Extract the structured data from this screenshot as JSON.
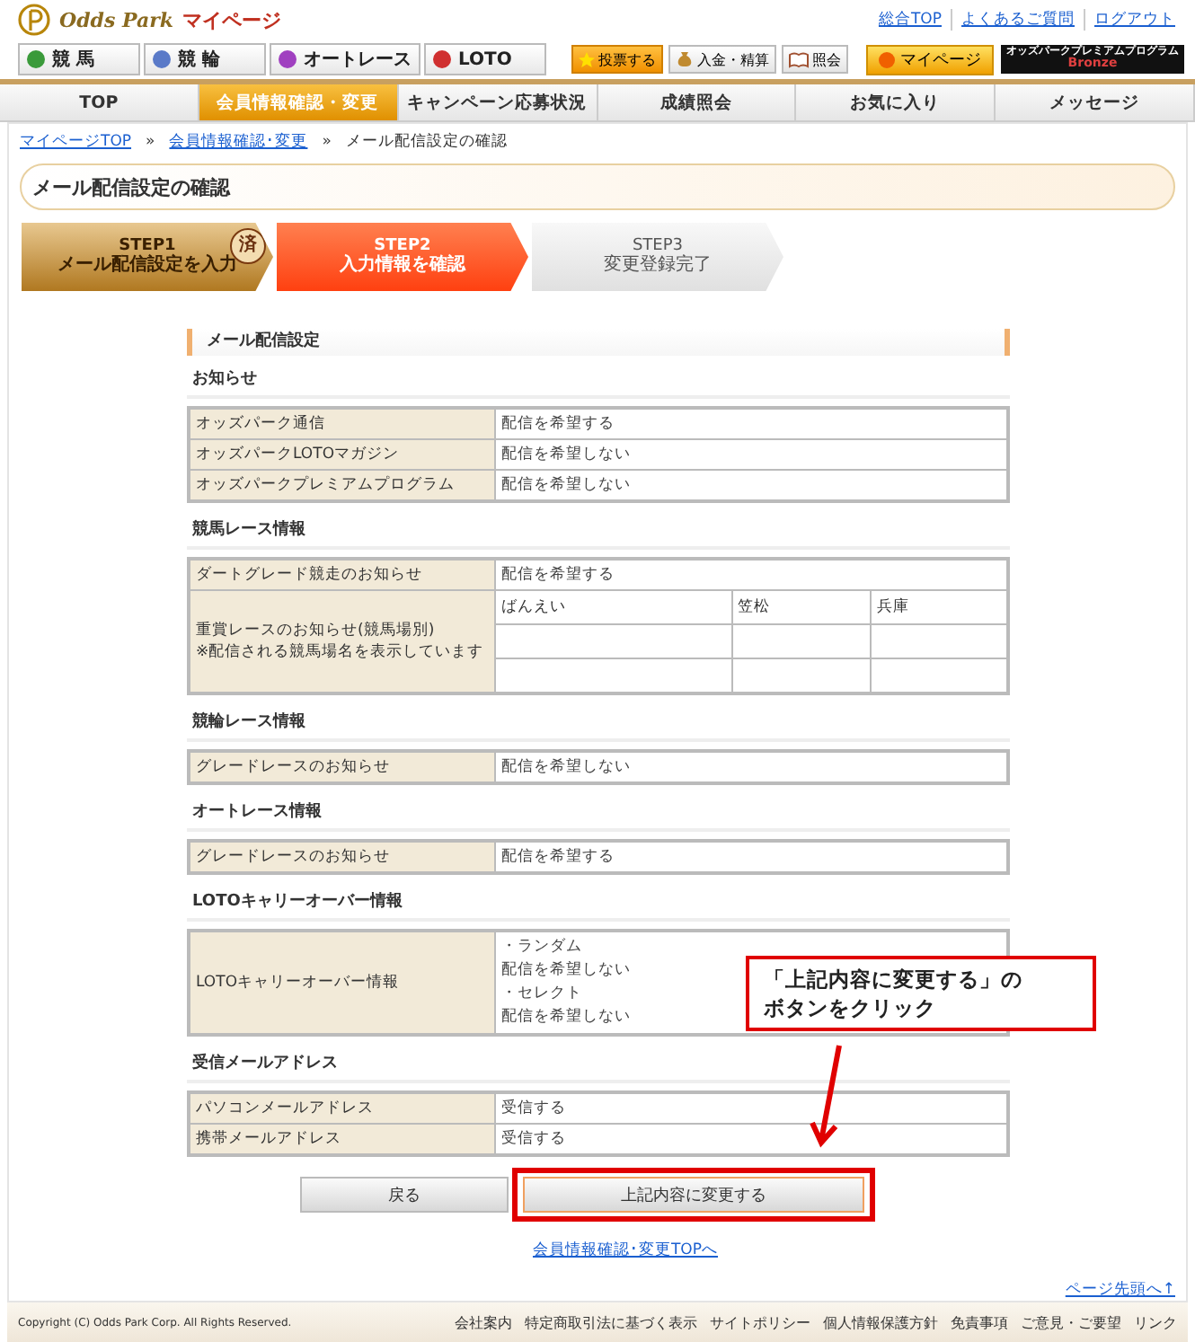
{
  "header": {
    "logo": "Odds Park",
    "logo_sub": "マイページ",
    "top_links": [
      "総合TOP",
      "よくあるご質問",
      "ログアウト"
    ],
    "sport_tabs": [
      {
        "label": "競 馬",
        "color": "#3a9a3a"
      },
      {
        "label": "競 輪",
        "color": "#5a7ac8"
      },
      {
        "label": "オートレース",
        "color": "#a040c0"
      },
      {
        "label": "LOTO",
        "color": "#d03030"
      }
    ],
    "actions": [
      {
        "label": "投票する",
        "kind": "vote"
      },
      {
        "label": "入金・精算",
        "kind": "money"
      },
      {
        "label": "照会",
        "kind": "book"
      }
    ],
    "mypage": "マイページ",
    "premium": {
      "title": "オッズパークプレミアムプログラム",
      "tier": "Bronze"
    }
  },
  "nav": [
    {
      "label": "TOP",
      "selected": false
    },
    {
      "label": "会員情報確認・変更",
      "selected": true
    },
    {
      "label": "キャンペーン応募状況",
      "selected": false
    },
    {
      "label": "成績照会",
      "selected": false
    },
    {
      "label": "お気に入り",
      "selected": false
    },
    {
      "label": "メッセージ",
      "selected": false
    }
  ],
  "breadcrumb": {
    "links": [
      "マイページTOP",
      "会員情報確認･変更"
    ],
    "separator": "»",
    "current": "メール配信設定の確認"
  },
  "page_title": "メール配信設定の確認",
  "steps": [
    {
      "step": "STEP1",
      "label": "メール配信設定を入力",
      "completed": true,
      "selected": false,
      "stamp": "済"
    },
    {
      "step": "STEP2",
      "label": "入力情報を確認",
      "completed": false,
      "selected": true
    },
    {
      "step": "STEP3",
      "label": "変更登録完了",
      "completed": false,
      "selected": false
    }
  ],
  "section_title": "メール配信設定",
  "groups": [
    {
      "title": "お知らせ",
      "rows": [
        {
          "kind": "text",
          "label": "オッズパーク通信",
          "value": "配信を希望する"
        },
        {
          "kind": "text",
          "label": "オッズパークLOTOマガジン",
          "value": "配信を希望しない"
        },
        {
          "kind": "text",
          "label": "オッズパークプレミアムプログラム",
          "value": "配信を希望しない"
        }
      ]
    },
    {
      "title": "競馬レース情報",
      "rows": [
        {
          "kind": "text",
          "label": "ダートグレード競走のお知らせ",
          "value": "配信を希望する"
        },
        {
          "kind": "venues",
          "label": "重賞レースのお知らせ(競馬場別)",
          "note": "※配信される競馬場名を表示しています",
          "venues": [
            "ばんえい",
            "笠松",
            "兵庫"
          ]
        }
      ]
    },
    {
      "title": "競輪レース情報",
      "rows": [
        {
          "kind": "text",
          "label": "グレードレースのお知らせ",
          "value": "配信を希望しない"
        }
      ]
    },
    {
      "title": "オートレース情報",
      "rows": [
        {
          "kind": "text",
          "label": "グレードレースのお知らせ",
          "value": "配信を希望する"
        }
      ]
    },
    {
      "title": "LOTOキャリーオーバー情報",
      "rows": [
        {
          "kind": "lines",
          "label": "LOTOキャリーオーバー情報",
          "lines": [
            "・ランダム",
            "配信を希望しない",
            "・セレクト",
            "配信を希望しない"
          ]
        }
      ]
    },
    {
      "title": "受信メールアドレス",
      "rows": [
        {
          "kind": "text",
          "label": "パソコンメールアドレス",
          "value": "受信する"
        },
        {
          "kind": "text",
          "label": "携帯メールアドレス",
          "value": "受信する"
        }
      ]
    }
  ],
  "buttons": {
    "back": "戻る",
    "submit": "上記内容に変更する"
  },
  "top_link": "会員情報確認･変更TOPへ",
  "page_top": "ページ先頭へ↑",
  "callout": [
    "「上記内容に変更する」の",
    "ボタンをクリック"
  ],
  "footer": {
    "copyright": "Copyright (C) Odds Park Corp. All Rights Reserved.",
    "links": [
      "会社案内",
      "特定商取引法に基づく表示",
      "サイトポリシー",
      "個人情報保護方針",
      "免責事項",
      "ご意見・ご要望",
      "リンク"
    ]
  }
}
